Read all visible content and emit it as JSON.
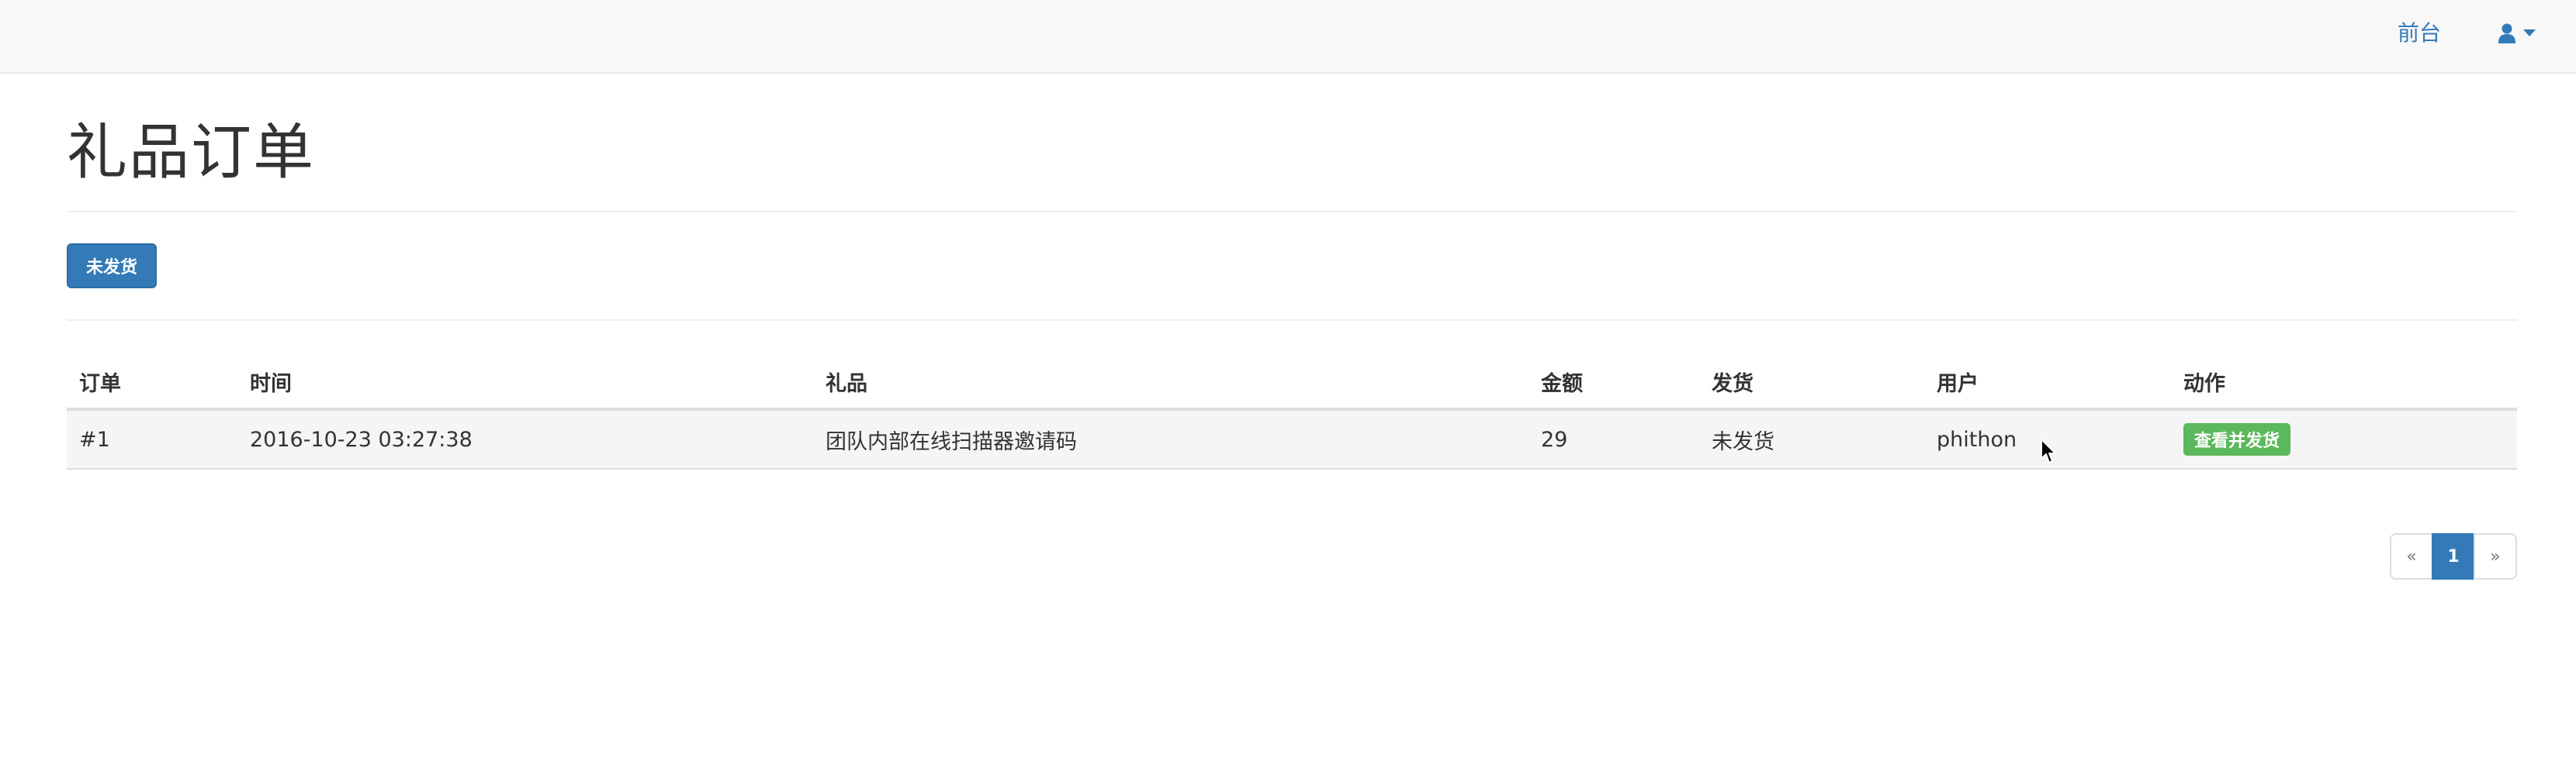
{
  "navbar": {
    "front_link": "前台",
    "user_icon": "user-icon",
    "dropdown_icon": "caret-down-icon"
  },
  "page": {
    "title": "礼品订单",
    "filter_button": "未发货"
  },
  "table": {
    "headers": [
      "订单",
      "时间",
      "礼品",
      "金额",
      "发货",
      "用户",
      "动作"
    ],
    "rows": [
      {
        "order": "#1",
        "time": "2016-10-23 03:27:38",
        "gift": "团队内部在线扫描器邀请码",
        "amount": "29",
        "shipping": "未发货",
        "user": "phithon",
        "action": "查看并发货"
      }
    ]
  },
  "pagination": {
    "prev": "«",
    "current": "1",
    "next": "»"
  },
  "colors": {
    "primary": "#337ab7",
    "success": "#5cb85c",
    "navbar_bg": "#f8f8f8"
  }
}
